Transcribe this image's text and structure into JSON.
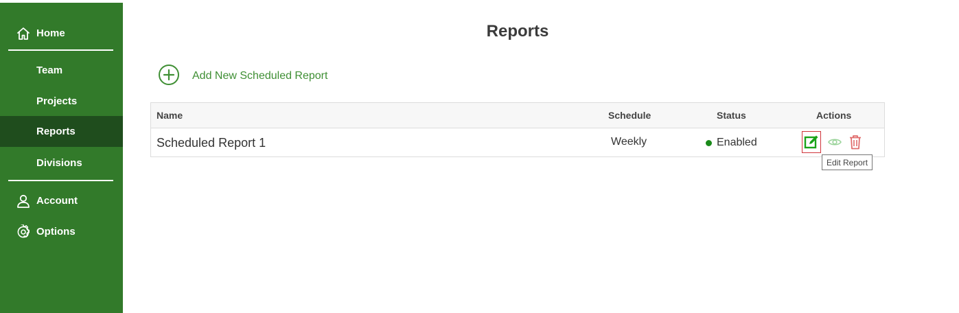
{
  "sidebar": {
    "items": [
      {
        "label": "Home",
        "icon": "home-icon"
      },
      {
        "label": "Team"
      },
      {
        "label": "Projects"
      },
      {
        "label": "Reports",
        "active": true
      },
      {
        "label": "Divisions"
      },
      {
        "label": "Account",
        "icon": "user-icon"
      },
      {
        "label": "Options",
        "icon": "gear-icon"
      }
    ],
    "colors": {
      "background": "#327a2a",
      "active": "#1f4d1d"
    }
  },
  "main": {
    "title": "Reports",
    "add_link": {
      "label": "Add New Scheduled Report",
      "icon": "plus-circle-icon",
      "color": "#3f8f34"
    },
    "table": {
      "columns": [
        "Name",
        "Schedule",
        "Status",
        "Actions"
      ],
      "rows": [
        {
          "name": "Scheduled Report 1",
          "schedule": "Weekly",
          "status": "Enabled",
          "actions": [
            "edit-icon",
            "eye-icon",
            "trash-icon"
          ]
        }
      ]
    },
    "tooltip": "Edit Report"
  }
}
